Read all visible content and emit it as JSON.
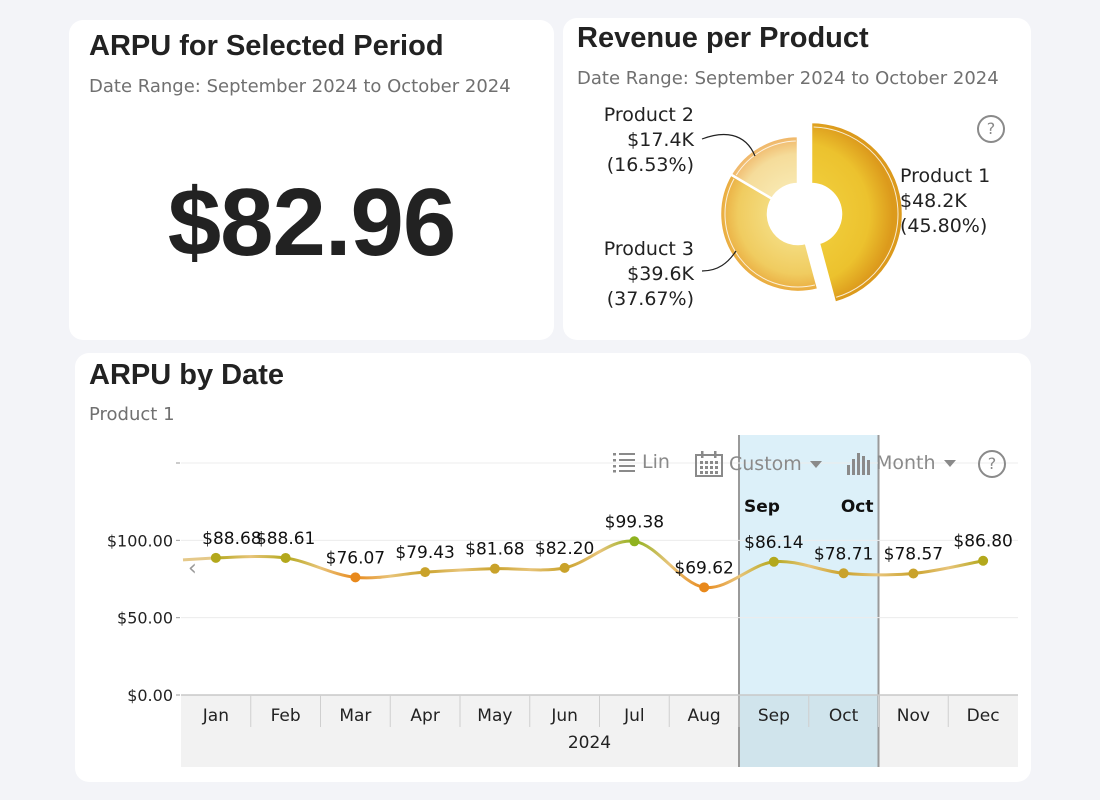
{
  "arpu_card": {
    "title": "ARPU for Selected Period",
    "subtitle": "Date Range: September 2024 to October 2024",
    "value": "$82.96"
  },
  "revenue_card": {
    "title": "Revenue per Product",
    "subtitle": "Date Range: September 2024 to October 2024",
    "help": "?"
  },
  "date_card": {
    "title": "ARPU by Date",
    "subtitle": "Product 1",
    "toolbar": {
      "scale_label": "Lin",
      "range_label": "Custom",
      "interval_label": "Month",
      "help": "?"
    },
    "selection": {
      "start_label": "Sep",
      "end_label": "Oct"
    },
    "scroll_left": "‹"
  },
  "colors": {
    "selection_fill": "#dcf0f9",
    "axis_band": "#f2f2f2",
    "line_green": "#8fb21f",
    "line_gold": "#c9a22a",
    "line_orange": "#e8891c"
  },
  "chart_data": [
    {
      "type": "pie",
      "variant": "donut",
      "title": "Revenue per Product",
      "slices": [
        {
          "label": "Product 1",
          "value_label": "$48.2K",
          "value": 48.2,
          "percent": 45.8,
          "percent_label": "(45.80%)",
          "color": "#ecc22e"
        },
        {
          "label": "Product 3",
          "value_label": "$39.6K",
          "value": 39.6,
          "percent": 37.67,
          "percent_label": "(37.67%)",
          "color": "#f1d068"
        },
        {
          "label": "Product 2",
          "value_label": "$17.4K",
          "value": 17.4,
          "percent": 16.53,
          "percent_label": "(16.53%)",
          "color": "#f6e1a0"
        }
      ]
    },
    {
      "type": "line",
      "title": "ARPU by Date",
      "subtitle": "Product 1",
      "categories": [
        "Jan",
        "Feb",
        "Mar",
        "Apr",
        "May",
        "Jun",
        "Jul",
        "Aug",
        "Sep",
        "Oct",
        "Nov",
        "Dec"
      ],
      "xlabel": "2024",
      "ylabel": "",
      "ylim": [
        0,
        150
      ],
      "yticks": [
        0,
        50,
        100,
        150
      ],
      "ytick_labels": [
        "$0.00",
        "$50.00",
        "$100.00",
        ""
      ],
      "series": [
        {
          "name": "ARPU",
          "values": [
            88.68,
            88.61,
            76.07,
            79.43,
            81.68,
            82.2,
            99.38,
            69.62,
            86.14,
            78.71,
            78.57,
            86.8
          ],
          "labels": [
            "$88.68",
            "$88.61",
            "$76.07",
            "$79.43",
            "$81.68",
            "$82.20",
            "$99.38",
            "$69.62",
            "$86.14",
            "$78.71",
            "$78.57",
            "$86.80"
          ]
        }
      ],
      "selected_range": [
        "Sep",
        "Oct"
      ],
      "grid": true,
      "legend": "none"
    }
  ]
}
